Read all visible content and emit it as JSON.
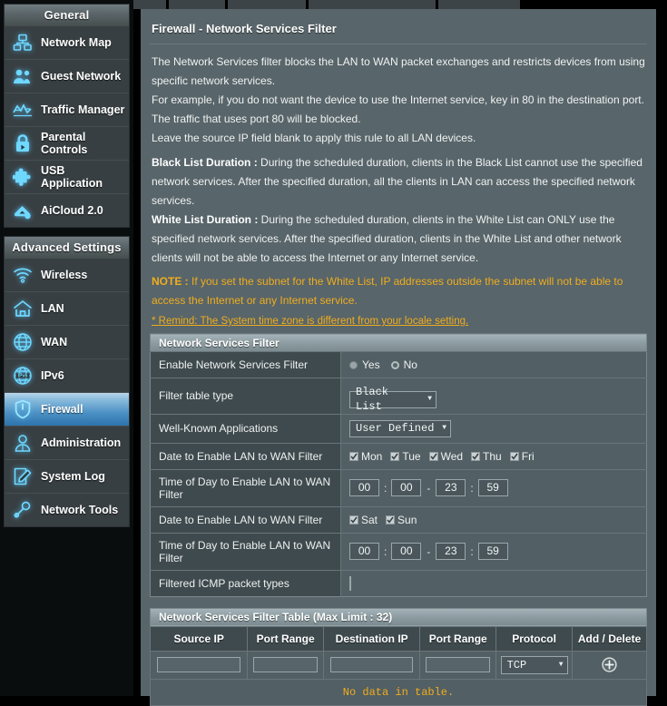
{
  "sidebar": {
    "general": {
      "title": "General",
      "items": [
        {
          "label": "Network Map",
          "icon": "network-map-icon"
        },
        {
          "label": "Guest Network",
          "icon": "guest-network-icon"
        },
        {
          "label": "Traffic Manager",
          "icon": "traffic-manager-icon"
        },
        {
          "label": "Parental Controls",
          "icon": "parental-controls-icon"
        },
        {
          "label": "USB Application",
          "icon": "usb-application-icon"
        },
        {
          "label": "AiCloud 2.0",
          "icon": "aicloud-icon"
        }
      ]
    },
    "advanced": {
      "title": "Advanced Settings",
      "items": [
        {
          "label": "Wireless",
          "icon": "wireless-icon",
          "active": false
        },
        {
          "label": "LAN",
          "icon": "lan-icon",
          "active": false
        },
        {
          "label": "WAN",
          "icon": "wan-icon",
          "active": false
        },
        {
          "label": "IPv6",
          "icon": "ipv6-icon",
          "active": false
        },
        {
          "label": "Firewall",
          "icon": "firewall-shield-icon",
          "active": true
        },
        {
          "label": "Administration",
          "icon": "administration-icon",
          "active": false
        },
        {
          "label": "System Log",
          "icon": "system-log-icon",
          "active": false
        },
        {
          "label": "Network Tools",
          "icon": "network-tools-icon",
          "active": false
        }
      ]
    }
  },
  "main": {
    "title": "Firewall - Network Services Filter",
    "description": [
      "The Network Services filter blocks the LAN to WAN packet exchanges and restricts devices from using specific network services.",
      "For example, if you do not want the device to use the Internet service, key in 80 in the destination port. The traffic that uses port 80 will be blocked.",
      "Leave the source IP field blank to apply this rule to all LAN devices."
    ],
    "black_list_label": "Black List Duration :",
    "black_list_text": " During the scheduled duration, clients in the Black List cannot use the specified network services. After the specified duration, all the clients in LAN can access the specified network services.",
    "white_list_label": "White List Duration :",
    "white_list_text": " During the scheduled duration, clients in the White List can ONLY use the specified network services. After the specified duration, clients in the White List and other network clients will not be able to access the Internet or any Internet service.",
    "note_label": "NOTE :",
    "note_text": " If you set the subnet for the White List, IP addresses outside the subnet will not be able to access the Internet or any Internet service.",
    "remind_link": "* Remind: The System time zone is different from your locale setting."
  },
  "filter_form": {
    "section_title": "Network Services Filter",
    "rows": {
      "enable_label": "Enable Network Services Filter",
      "enable_yes": "Yes",
      "enable_no": "No",
      "enable_selected": "Yes",
      "table_type_label": "Filter table type",
      "table_type_value": "Black List",
      "apps_label": "Well-Known Applications",
      "apps_value": "User Defined",
      "date_weekday_label": "Date to Enable LAN to WAN Filter",
      "time_weekday_label": "Time of Day to Enable LAN to WAN Filter",
      "date_weekend_label": "Date to Enable LAN to WAN Filter",
      "time_weekend_label": "Time of Day to Enable LAN to WAN Filter",
      "icmp_label": "Filtered ICMP packet types",
      "icmp_value": ""
    },
    "weekdays": [
      {
        "label": "Mon",
        "checked": true
      },
      {
        "label": "Tue",
        "checked": true
      },
      {
        "label": "Wed",
        "checked": true
      },
      {
        "label": "Thu",
        "checked": true
      },
      {
        "label": "Fri",
        "checked": true
      }
    ],
    "weekend": [
      {
        "label": "Sat",
        "checked": true
      },
      {
        "label": "Sun",
        "checked": true
      }
    ],
    "time_weekday": {
      "start_hour": "00",
      "start_min": "00",
      "end_hour": "23",
      "end_min": "59"
    },
    "time_weekend": {
      "start_hour": "00",
      "start_min": "00",
      "end_hour": "23",
      "end_min": "59"
    },
    "time_colon": ":",
    "time_dash": "-"
  },
  "filter_table": {
    "section_title": "Network Services Filter Table (Max Limit : 32)",
    "columns": [
      "Source IP",
      "Port Range",
      "Destination IP",
      "Port Range",
      "Protocol",
      "Add / Delete"
    ],
    "new_row": {
      "source_ip": "",
      "source_port": "",
      "destination_ip": "",
      "destination_port": "",
      "protocol": "TCP"
    },
    "empty_message": "No data in table."
  },
  "colors": {
    "accent_yellow": "#f0ad1e",
    "panel_bg": "#58656a",
    "sidebar_bg": "#383f42",
    "active_blue": "#4a90c4",
    "icon_cyan": "#6fd8ff"
  }
}
